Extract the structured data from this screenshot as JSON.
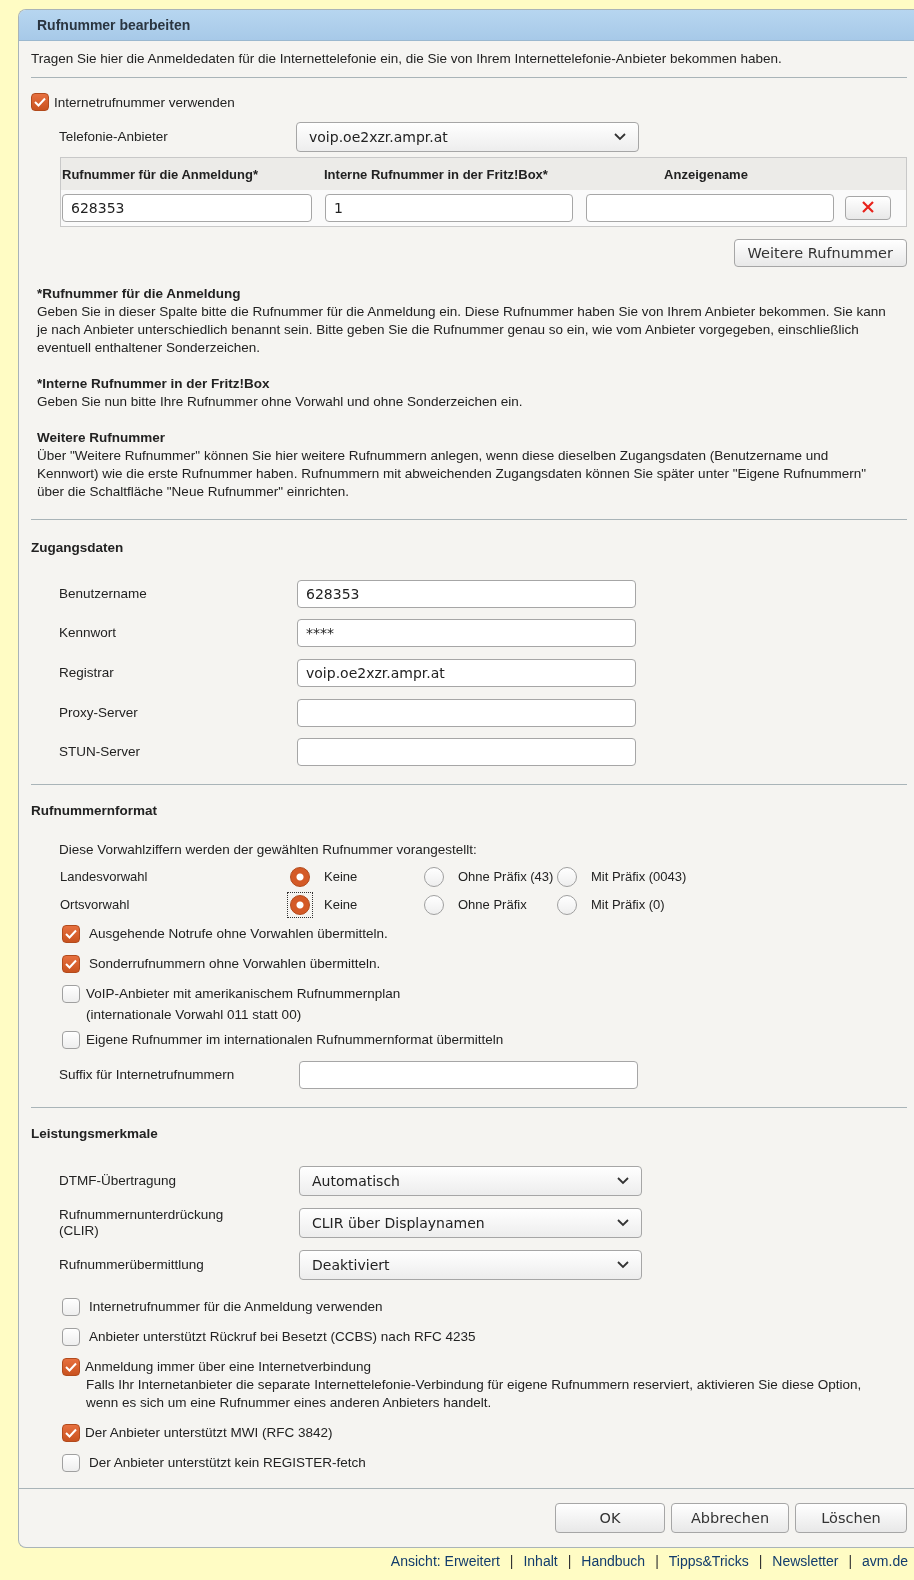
{
  "title": "Rufnummer bearbeiten",
  "intro": "Tragen Sie hier die Anmeldedaten für die Internettelefonie ein, die Sie von Ihrem Internettelefonie-Anbieter bekommen haben.",
  "use_internet_number": {
    "label": "Internetrufnummer verwenden",
    "checked": true
  },
  "provider": {
    "label": "Telefonie-Anbieter",
    "value": "voip.oe2xzr.ampr.at"
  },
  "numbers_table": {
    "columns": [
      "Rufnummer für die Anmeldung*",
      "Interne Rufnummer in der Fritz!Box*",
      "Anzeigename"
    ],
    "rows": [
      {
        "login": "628353",
        "internal": "1"
      }
    ]
  },
  "more_button": "Weitere Rufnummer",
  "help": [
    {
      "heading": "*Rufnummer für die Anmeldung",
      "text": "Geben Sie in dieser Spalte bitte die Rufnummer für die Anmeldung ein. Diese Rufnummer haben Sie von Ihrem Anbieter bekommen. Sie kann je nach Anbieter unterschiedlich benannt sein. Bitte geben Sie die Rufnummer genau so ein, wie vom Anbieter vorgegeben, einschließlich eventuell enthaltener Sonderzeichen."
    },
    {
      "heading": "*Interne Rufnummer in der Fritz!Box",
      "text": "Geben Sie nun bitte Ihre Rufnummer ohne Vorwahl und ohne Sonderzeichen ein."
    },
    {
      "heading": "Weitere Rufnummer",
      "text": "Über \"Weitere Rufnummer\" können Sie hier weitere Rufnummern anlegen, wenn diese dieselben Zugangsdaten (Benutzername und Kennwort) wie die erste Rufnummer haben. Rufnummern mit abweichenden Zugangsdaten können Sie später unter \"Eigene Rufnummern\" über die Schaltfläche \"Neue Rufnummer\" einrichten."
    }
  ],
  "access": {
    "title": "Zugangsdaten",
    "fields": [
      {
        "label": "Benutzername",
        "value": "628353"
      },
      {
        "label": "Kennwort",
        "value": "****"
      },
      {
        "label": "Registrar",
        "value": "voip.oe2xzr.ampr.at"
      },
      {
        "label": "Proxy-Server"
      },
      {
        "label": "STUN-Server"
      }
    ]
  },
  "number_format": {
    "title": "Rufnummernformat",
    "intro": "Diese Vorwahlziffern werden der gewählten Rufnummer vorangestellt:",
    "radio_groups": [
      {
        "label": "Landesvorwahl",
        "options": [
          {
            "label": "Keine",
            "selected": true,
            "focused": false
          },
          {
            "label": "Ohne Präfix (43)",
            "selected": false,
            "focused": false
          },
          {
            "label": "Mit Präfix (0043)",
            "selected": false,
            "focused": false
          }
        ]
      },
      {
        "label": "Ortsvorwahl",
        "options": [
          {
            "label": "Keine",
            "selected": true,
            "focused": true
          },
          {
            "label": "Ohne Präfix",
            "selected": false,
            "focused": false
          },
          {
            "label": "Mit Präfix (0)",
            "selected": false,
            "focused": false
          }
        ]
      }
    ],
    "checkboxes": [
      {
        "label": "Ausgehende Notrufe ohne Vorwahlen übermitteln.",
        "checked": true
      },
      {
        "label": "Sonderrufnummern ohne Vorwahlen übermitteln.",
        "checked": true
      },
      {
        "label": "VoIP-Anbieter mit amerikanischem Rufnummernplan",
        "note": "(internationale Vorwahl 011 statt 00)",
        "checked": false
      },
      {
        "label": "Eigene Rufnummer im internationalen Rufnummernformat übermitteln",
        "checked": false
      }
    ],
    "suffix": {
      "label": "Suffix für Internetrufnummern"
    }
  },
  "features": {
    "title": "Leistungsmerkmale",
    "selects": [
      {
        "label": "DTMF-Übertragung",
        "value": "Automatisch"
      },
      {
        "label": "Rufnummernunterdrückung (CLIR)",
        "value": "CLIR über Displaynamen"
      },
      {
        "label": "Rufnummerübermittlung",
        "value": "Deaktiviert"
      }
    ],
    "checkboxes": [
      {
        "label": "Internetrufnummer für die Anmeldung verwenden",
        "checked": false
      },
      {
        "label": "Anbieter unterstützt Rückruf bei Besetzt (CCBS) nach RFC 4235",
        "checked": false
      },
      {
        "label": "Anmeldung immer über eine Internetverbindung",
        "note": "Falls Ihr Internetanbieter die separate Internettelefonie-Verbindung für eigene Rufnummern reserviert, aktivieren Sie diese Option, wenn es sich um eine Rufnummer eines anderen Anbieters handelt.",
        "checked": true
      },
      {
        "label": "Der Anbieter unterstützt MWI (RFC 3842)",
        "checked": true
      },
      {
        "label": "Der Anbieter unterstützt kein REGISTER-fetch",
        "checked": false
      }
    ]
  },
  "buttons": [
    "OK",
    "Abbrechen",
    "Löschen"
  ],
  "footer_links": [
    {
      "label": "Ansicht: Erweitert"
    },
    {
      "separator": "|",
      "label": "Inhalt"
    },
    {
      "separator": "|",
      "label": "Handbuch"
    },
    {
      "separator": "|",
      "label": "Tipps&Tricks"
    },
    {
      "separator": "|",
      "label": "Newsletter"
    },
    {
      "separator": "|",
      "label": "avm.de"
    }
  ]
}
